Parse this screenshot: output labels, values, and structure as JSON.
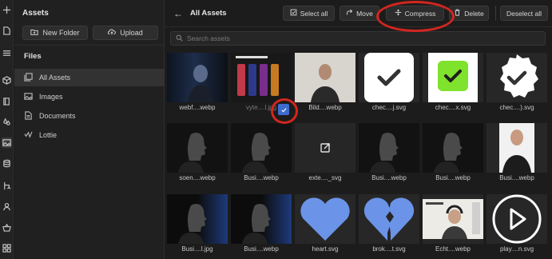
{
  "rail": [
    "plus-icon",
    "page-icon",
    "menu-icon",
    "cube-icon",
    "book-icon",
    "drops-icon",
    "image-icon",
    "database-icon",
    "flow-icon",
    "user-icon",
    "basket-icon",
    "apps-icon"
  ],
  "panel": {
    "title": "Assets",
    "new_folder": "New Folder",
    "upload": "Upload",
    "files_title": "Files",
    "nav": [
      {
        "label": "All Assets",
        "icon": "stack-icon",
        "active": true
      },
      {
        "label": "Images",
        "icon": "image-icon",
        "active": false
      },
      {
        "label": "Documents",
        "icon": "document-icon",
        "active": false
      },
      {
        "label": "Lottie",
        "icon": "lottie-icon",
        "active": false
      }
    ]
  },
  "main": {
    "title": "All Assets",
    "toolbar": {
      "select_all": "Select all",
      "move": "Move",
      "compress": "Compress",
      "delete": "Delete",
      "deselect_all": "Deselect all"
    },
    "search_placeholder": "Search assets",
    "assets": [
      {
        "name": "webf....webp",
        "kind": "photo-dark-profile",
        "selected": false
      },
      {
        "name": "vyte....l.jpg",
        "kind": "bottles",
        "selected": true
      },
      {
        "name": "Bild....webp",
        "kind": "photo-person-light",
        "selected": false
      },
      {
        "name": "chec....j.svg",
        "kind": "check-white",
        "selected": false
      },
      {
        "name": "chec....x.svg",
        "kind": "check-green",
        "selected": false
      },
      {
        "name": "chec....).svg",
        "kind": "check-badge",
        "selected": false
      },
      {
        "name": "soen....webp",
        "kind": "photo-profile",
        "selected": false
      },
      {
        "name": "Busi....webp",
        "kind": "photo-profile",
        "selected": false
      },
      {
        "name": "exte...._svg",
        "kind": "external",
        "selected": false
      },
      {
        "name": "Busi....webp",
        "kind": "photo-profile",
        "selected": false
      },
      {
        "name": "Busi....webp",
        "kind": "photo-profile",
        "selected": false
      },
      {
        "name": "Busi....webp",
        "kind": "photo-person-white",
        "selected": false
      },
      {
        "name": "Busi....l.jpg",
        "kind": "photo-profile-blue",
        "selected": false
      },
      {
        "name": "Busi....webp",
        "kind": "photo-profile-blue",
        "selected": false
      },
      {
        "name": "heart.svg",
        "kind": "heart",
        "selected": false
      },
      {
        "name": "brok....t.svg",
        "kind": "broken-heart",
        "selected": false
      },
      {
        "name": "Echt....webp",
        "kind": "webcam",
        "selected": false
      },
      {
        "name": "play....n.svg",
        "kind": "play",
        "selected": false
      }
    ]
  },
  "colors": {
    "accent_blue": "#3d6bd0",
    "annotation_red": "#d3261e",
    "check_green": "#7fe22c",
    "heart_blue": "#6b93e8"
  }
}
